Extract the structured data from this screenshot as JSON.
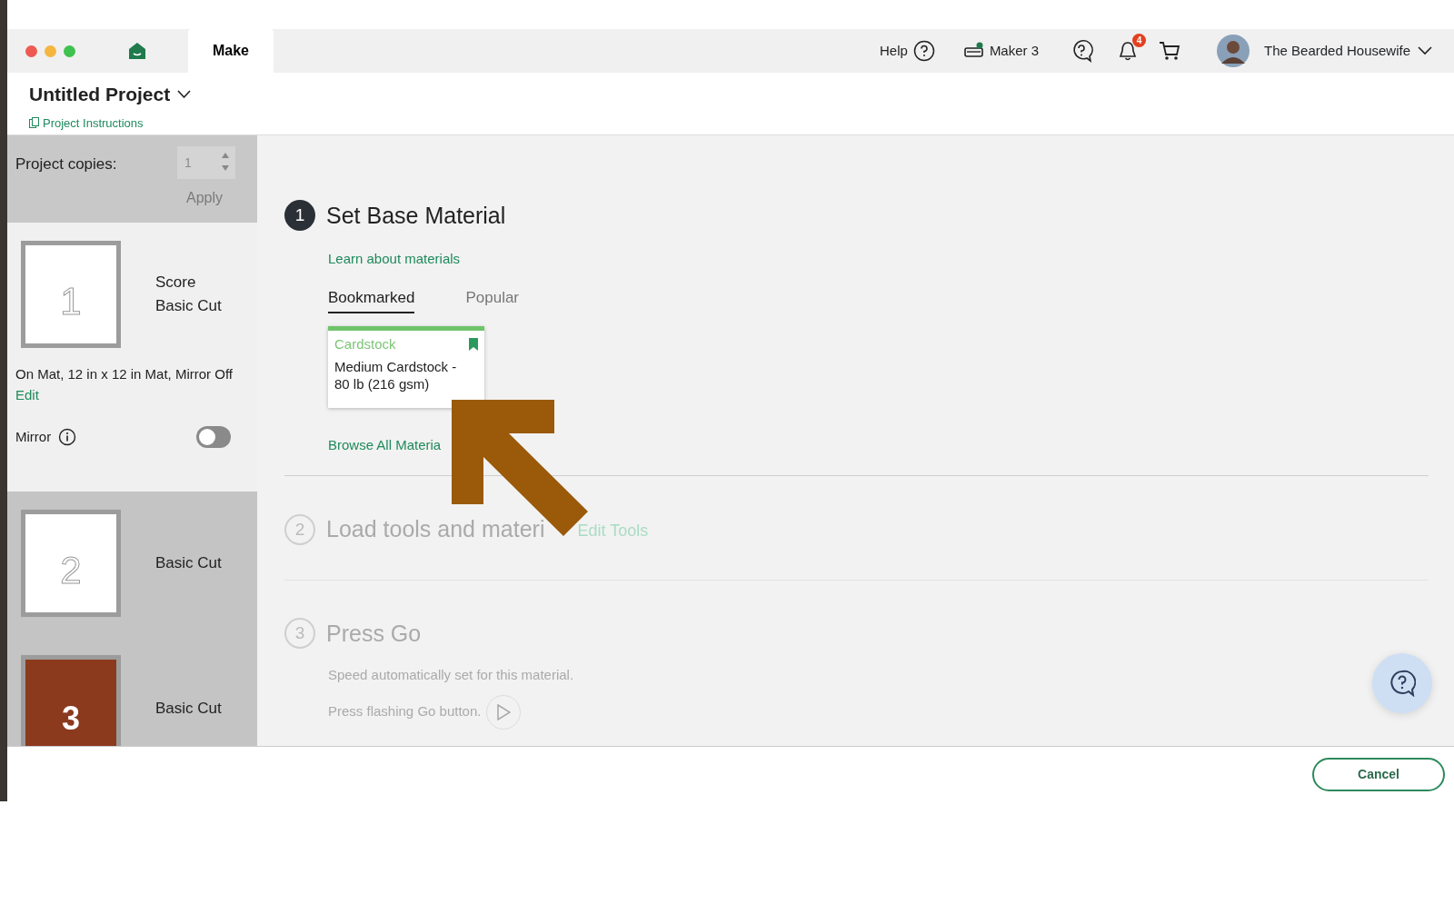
{
  "tabs": [
    {
      "label": "Make",
      "selected": true
    }
  ],
  "toolbar": {
    "help": "Help",
    "machine": "Maker 3",
    "machine_connected": true,
    "notifications": "4",
    "user": "The Bearded Housewife"
  },
  "project": {
    "title": "Untitled Project",
    "instructions": "Project Instructions"
  },
  "copies": {
    "label": "Project copies:",
    "value": "1",
    "apply": "Apply",
    "disabled": true
  },
  "mats": [
    {
      "number": "1",
      "operations": [
        "Score",
        "Basic Cut"
      ],
      "selected": true,
      "color": "#ffffff"
    },
    {
      "number": "2",
      "operations": [
        "Basic Cut"
      ],
      "selected": false,
      "color": "#ffffff"
    },
    {
      "number": "3",
      "operations": [
        "Basic Cut"
      ],
      "selected": false,
      "color": "#8b3a1e"
    }
  ],
  "mat_settings": {
    "summary": "On Mat, 12 in x 12 in Mat, Mirror Off",
    "edit": "Edit",
    "mirror_label": "Mirror",
    "mirror_on": false
  },
  "steps": [
    {
      "number": "1",
      "title": "Set Base Material",
      "active": true,
      "link": "Learn about materials",
      "tabs": [
        {
          "label": "Bookmarked",
          "selected": true
        },
        {
          "label": "Popular",
          "selected": false
        }
      ],
      "material": {
        "category": "Cardstock",
        "name": "Medium Cardstock - 80 lb (216 gsm)",
        "bookmarked": true
      },
      "browse": "Browse All Materia"
    },
    {
      "number": "2",
      "title": "Load tools and materi",
      "active": false,
      "action": "Edit Tools"
    },
    {
      "number": "3",
      "title": "Press Go",
      "active": false,
      "lines": [
        "Speed automatically set for this material.",
        "Press flashing Go button."
      ]
    }
  ],
  "footer": {
    "cancel": "Cancel"
  }
}
